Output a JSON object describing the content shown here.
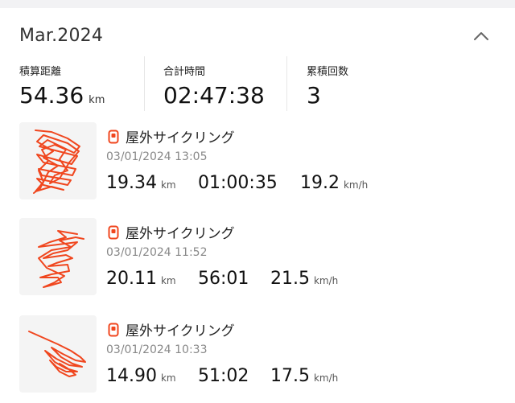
{
  "header": {
    "month": "Mar.2024"
  },
  "summary": {
    "distance": {
      "label": "積算距離",
      "value": "54.36",
      "unit": "km"
    },
    "time": {
      "label": "合計時間",
      "value": "02:47:38"
    },
    "count": {
      "label": "累積回数",
      "value": "3"
    }
  },
  "activities": [
    {
      "title": "屋外サイクリング",
      "date": "03/01/2024 13:05",
      "distance": "19.34",
      "distance_unit": "km",
      "duration": "01:00:35",
      "speed": "19.2",
      "speed_unit": "km/h"
    },
    {
      "title": "屋外サイクリング",
      "date": "03/01/2024 11:52",
      "distance": "20.11",
      "distance_unit": "km",
      "duration": "56:01",
      "speed": "21.5",
      "speed_unit": "km/h"
    },
    {
      "title": "屋外サイクリング",
      "date": "03/01/2024 10:33",
      "distance": "14.90",
      "distance_unit": "km",
      "duration": "51:02",
      "speed": "17.5",
      "speed_unit": "km/h"
    }
  ],
  "colors": {
    "accent": "#f0461e",
    "route": "#f0461e",
    "thumb_bg": "#f4f4f4",
    "divider": "#e6e6e6"
  },
  "icons": {
    "collapse": "chevron-up-icon",
    "activity": "bicycle-type-icon"
  }
}
